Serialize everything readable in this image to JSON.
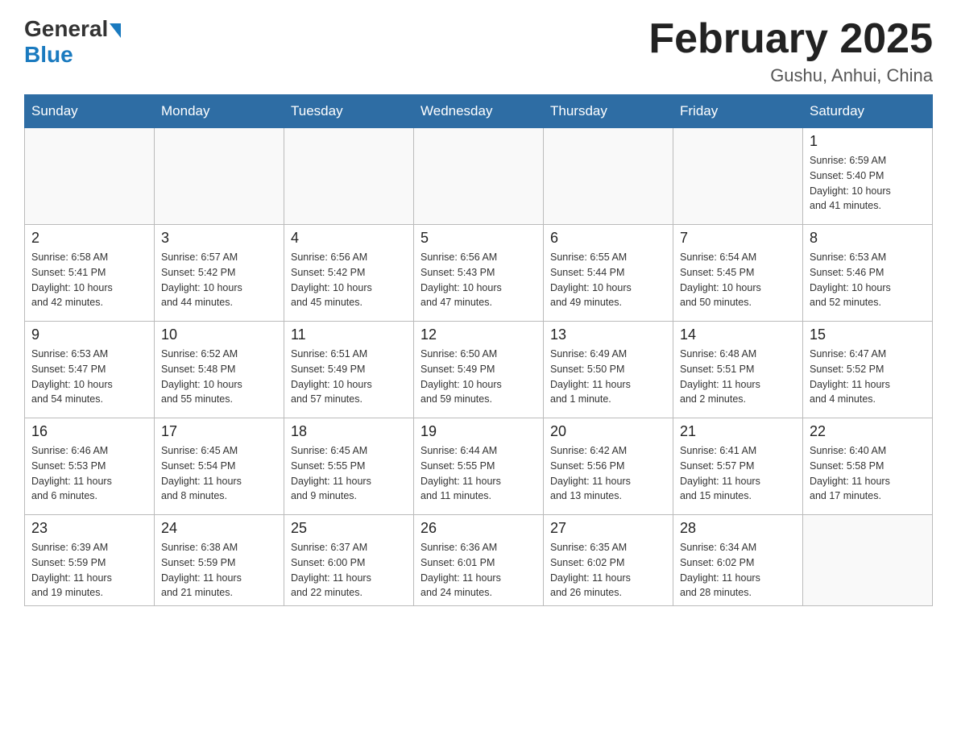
{
  "header": {
    "logo_general": "General",
    "logo_blue": "Blue",
    "month_title": "February 2025",
    "location": "Gushu, Anhui, China"
  },
  "weekdays": [
    "Sunday",
    "Monday",
    "Tuesday",
    "Wednesday",
    "Thursday",
    "Friday",
    "Saturday"
  ],
  "weeks": [
    [
      {
        "day": "",
        "info": ""
      },
      {
        "day": "",
        "info": ""
      },
      {
        "day": "",
        "info": ""
      },
      {
        "day": "",
        "info": ""
      },
      {
        "day": "",
        "info": ""
      },
      {
        "day": "",
        "info": ""
      },
      {
        "day": "1",
        "info": "Sunrise: 6:59 AM\nSunset: 5:40 PM\nDaylight: 10 hours\nand 41 minutes."
      }
    ],
    [
      {
        "day": "2",
        "info": "Sunrise: 6:58 AM\nSunset: 5:41 PM\nDaylight: 10 hours\nand 42 minutes."
      },
      {
        "day": "3",
        "info": "Sunrise: 6:57 AM\nSunset: 5:42 PM\nDaylight: 10 hours\nand 44 minutes."
      },
      {
        "day": "4",
        "info": "Sunrise: 6:56 AM\nSunset: 5:42 PM\nDaylight: 10 hours\nand 45 minutes."
      },
      {
        "day": "5",
        "info": "Sunrise: 6:56 AM\nSunset: 5:43 PM\nDaylight: 10 hours\nand 47 minutes."
      },
      {
        "day": "6",
        "info": "Sunrise: 6:55 AM\nSunset: 5:44 PM\nDaylight: 10 hours\nand 49 minutes."
      },
      {
        "day": "7",
        "info": "Sunrise: 6:54 AM\nSunset: 5:45 PM\nDaylight: 10 hours\nand 50 minutes."
      },
      {
        "day": "8",
        "info": "Sunrise: 6:53 AM\nSunset: 5:46 PM\nDaylight: 10 hours\nand 52 minutes."
      }
    ],
    [
      {
        "day": "9",
        "info": "Sunrise: 6:53 AM\nSunset: 5:47 PM\nDaylight: 10 hours\nand 54 minutes."
      },
      {
        "day": "10",
        "info": "Sunrise: 6:52 AM\nSunset: 5:48 PM\nDaylight: 10 hours\nand 55 minutes."
      },
      {
        "day": "11",
        "info": "Sunrise: 6:51 AM\nSunset: 5:49 PM\nDaylight: 10 hours\nand 57 minutes."
      },
      {
        "day": "12",
        "info": "Sunrise: 6:50 AM\nSunset: 5:49 PM\nDaylight: 10 hours\nand 59 minutes."
      },
      {
        "day": "13",
        "info": "Sunrise: 6:49 AM\nSunset: 5:50 PM\nDaylight: 11 hours\nand 1 minute."
      },
      {
        "day": "14",
        "info": "Sunrise: 6:48 AM\nSunset: 5:51 PM\nDaylight: 11 hours\nand 2 minutes."
      },
      {
        "day": "15",
        "info": "Sunrise: 6:47 AM\nSunset: 5:52 PM\nDaylight: 11 hours\nand 4 minutes."
      }
    ],
    [
      {
        "day": "16",
        "info": "Sunrise: 6:46 AM\nSunset: 5:53 PM\nDaylight: 11 hours\nand 6 minutes."
      },
      {
        "day": "17",
        "info": "Sunrise: 6:45 AM\nSunset: 5:54 PM\nDaylight: 11 hours\nand 8 minutes."
      },
      {
        "day": "18",
        "info": "Sunrise: 6:45 AM\nSunset: 5:55 PM\nDaylight: 11 hours\nand 9 minutes."
      },
      {
        "day": "19",
        "info": "Sunrise: 6:44 AM\nSunset: 5:55 PM\nDaylight: 11 hours\nand 11 minutes."
      },
      {
        "day": "20",
        "info": "Sunrise: 6:42 AM\nSunset: 5:56 PM\nDaylight: 11 hours\nand 13 minutes."
      },
      {
        "day": "21",
        "info": "Sunrise: 6:41 AM\nSunset: 5:57 PM\nDaylight: 11 hours\nand 15 minutes."
      },
      {
        "day": "22",
        "info": "Sunrise: 6:40 AM\nSunset: 5:58 PM\nDaylight: 11 hours\nand 17 minutes."
      }
    ],
    [
      {
        "day": "23",
        "info": "Sunrise: 6:39 AM\nSunset: 5:59 PM\nDaylight: 11 hours\nand 19 minutes."
      },
      {
        "day": "24",
        "info": "Sunrise: 6:38 AM\nSunset: 5:59 PM\nDaylight: 11 hours\nand 21 minutes."
      },
      {
        "day": "25",
        "info": "Sunrise: 6:37 AM\nSunset: 6:00 PM\nDaylight: 11 hours\nand 22 minutes."
      },
      {
        "day": "26",
        "info": "Sunrise: 6:36 AM\nSunset: 6:01 PM\nDaylight: 11 hours\nand 24 minutes."
      },
      {
        "day": "27",
        "info": "Sunrise: 6:35 AM\nSunset: 6:02 PM\nDaylight: 11 hours\nand 26 minutes."
      },
      {
        "day": "28",
        "info": "Sunrise: 6:34 AM\nSunset: 6:02 PM\nDaylight: 11 hours\nand 28 minutes."
      },
      {
        "day": "",
        "info": ""
      }
    ]
  ]
}
